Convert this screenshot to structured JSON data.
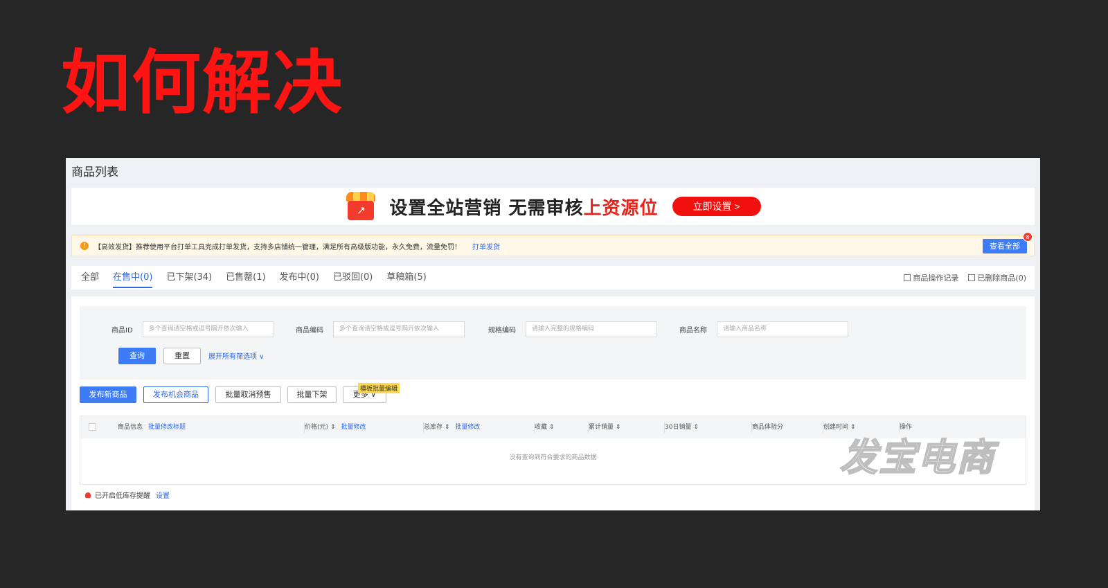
{
  "headline": "如何解决",
  "page_title": "商品列表",
  "banner": {
    "slogan": "设置全站营销 无需审核",
    "slogan_highlight": "上资源位",
    "cta_label": "立即设置 >"
  },
  "notice": {
    "text": "【高效发货】推荐使用平台打单工具完成打单发货，支持多店铺统一管理，满足所有高级版功能，永久免费，流量免罚！",
    "link_label": "打单发货",
    "view_all_label": "查看全部",
    "badge": "8"
  },
  "tabs": [
    {
      "label": "全部"
    },
    {
      "label": "在售中(0)"
    },
    {
      "label": "已下架(34)"
    },
    {
      "label": "已售罄(1)"
    },
    {
      "label": "发布中(0)"
    },
    {
      "label": "已驳回(0)"
    },
    {
      "label": "草稿箱(5)"
    }
  ],
  "tab_actions": {
    "log_label": "商品操作记录",
    "deleted_label": "已删除商品(0)"
  },
  "filters": [
    {
      "label": "商品ID",
      "placeholder": "多个查询请空格或逗号隔开依次输入"
    },
    {
      "label": "商品编码",
      "placeholder": "多个查询请空格或逗号隔开依次输入"
    },
    {
      "label": "规格编码",
      "placeholder": "请输入完整的规格编码"
    },
    {
      "label": "商品名称",
      "placeholder": "请输入商品名称"
    }
  ],
  "filter_actions": {
    "query_label": "查询",
    "reset_label": "重置",
    "expand_label": "展开所有筛选项 ∨"
  },
  "toolbar": {
    "publish_new": "发布新商品",
    "publish_opportunity": "发布机会商品",
    "batch_cancel_presale": "批量取消预售",
    "batch_off_shelf": "批量下架",
    "more": "更多 ∨",
    "more_tip": "模板批量编辑"
  },
  "table": {
    "columns": [
      {
        "label": "商品信息",
        "action": "批量修改标题"
      },
      {
        "label": "价格(元) ⇕",
        "action": "批量修改"
      },
      {
        "label": "总库存 ⇕",
        "action": "批量修改"
      },
      {
        "label": "收藏 ⇕",
        "action": ""
      },
      {
        "label": "累计销量 ⇕",
        "action": ""
      },
      {
        "label": "30日销量 ⇕",
        "action": ""
      },
      {
        "label": "商品体验分",
        "action": ""
      },
      {
        "label": "创建时间 ⇕",
        "action": ""
      },
      {
        "label": "操作",
        "action": ""
      }
    ],
    "empty_text": "没有查询到符合要求的商品数据"
  },
  "watermark": "发宝电商",
  "low_stock": {
    "text": "已开启低库存提醒",
    "link": "设置"
  }
}
